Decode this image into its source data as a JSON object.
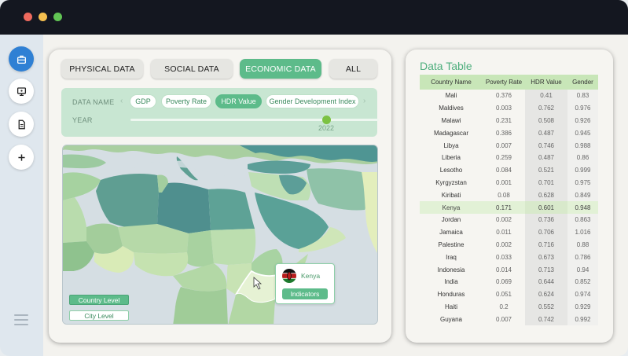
{
  "tabs": [
    {
      "label": "PHYSICAL DATA",
      "active": false
    },
    {
      "label": "SOCIAL DATA",
      "active": false
    },
    {
      "label": "ECONOMIC DATA",
      "active": true
    },
    {
      "label": "ALL",
      "active": false
    }
  ],
  "filters": {
    "data_name_label": "DATA NAME",
    "year_label": "YEAR",
    "chips": [
      "GDP",
      "Poverty Rate",
      "HDR Value",
      "Gender Development Index"
    ],
    "selected_chip": "HDR Value",
    "year_value": "2022"
  },
  "map": {
    "popup_country": "Kenya",
    "popup_button": "Indicators",
    "country_level_label": "Country Level",
    "city_level_label": "City Level"
  },
  "data_table": {
    "title": "Data Table",
    "columns": [
      "Country Name",
      "Poverty Rate",
      "HDR Value",
      "Gender"
    ],
    "selected_row": "Kenya",
    "rows": [
      [
        "Mali",
        "0.376",
        "0.41",
        "0.83"
      ],
      [
        "Maldives",
        "0.003",
        "0.762",
        "0.976"
      ],
      [
        "Malawi",
        "0.231",
        "0.508",
        "0.926"
      ],
      [
        "Madagascar",
        "0.386",
        "0.487",
        "0.945"
      ],
      [
        "Libya",
        "0.007",
        "0.746",
        "0.988"
      ],
      [
        "Liberia",
        "0.259",
        "0.487",
        "0.86"
      ],
      [
        "Lesotho",
        "0.084",
        "0.521",
        "0.999"
      ],
      [
        "Kyrgyzstan",
        "0.001",
        "0.701",
        "0.975"
      ],
      [
        "Kiribati",
        "0.08",
        "0.628",
        "0.849"
      ],
      [
        "Kenya",
        "0.171",
        "0.601",
        "0.948"
      ],
      [
        "Jordan",
        "0.002",
        "0.736",
        "0.863"
      ],
      [
        "Jamaica",
        "0.011",
        "0.706",
        "1.016"
      ],
      [
        "Palestine",
        "0.002",
        "0.716",
        "0.88"
      ],
      [
        "Iraq",
        "0.033",
        "0.673",
        "0.786"
      ],
      [
        "Indonesia",
        "0.014",
        "0.713",
        "0.94"
      ],
      [
        "India",
        "0.069",
        "0.644",
        "0.852"
      ],
      [
        "Honduras",
        "0.051",
        "0.624",
        "0.974"
      ],
      [
        "Haiti",
        "0.2",
        "0.552",
        "0.929"
      ],
      [
        "Guyana",
        "0.007",
        "0.742",
        "0.992"
      ]
    ]
  },
  "sidebar": {
    "items": [
      "briefcase-icon",
      "monitor-icon",
      "document-icon",
      "plus-icon"
    ],
    "menu_icon": "hamburger-icon"
  },
  "colors": {
    "accent": "#5dbb8a",
    "chip_border": "#bfe0c9",
    "table_header": "#c8e6b8",
    "sidebar_active": "#2f80d4"
  }
}
